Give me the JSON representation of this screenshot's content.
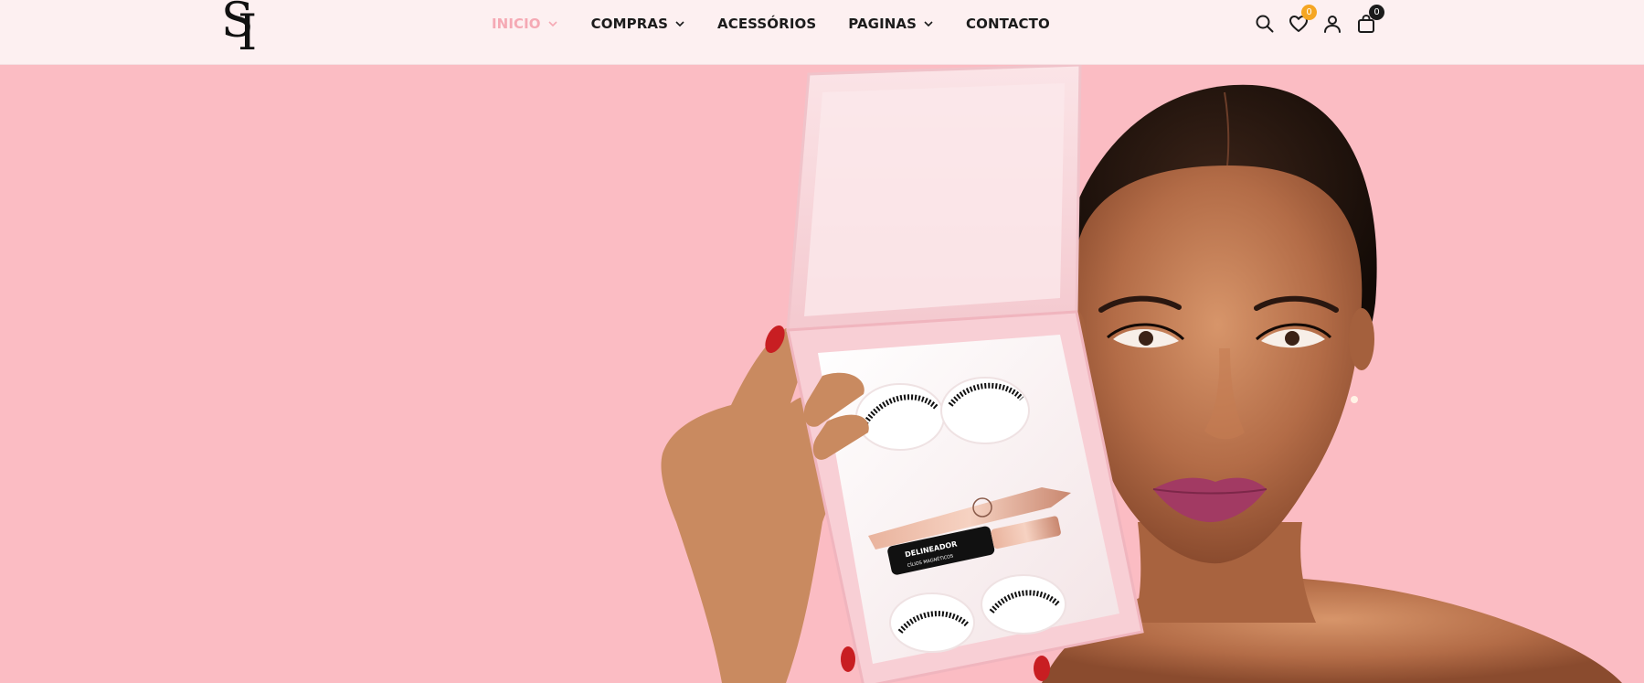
{
  "header": {
    "logo_text": "SI",
    "nav": [
      {
        "label": "INICIO",
        "has_dropdown": true,
        "active": true
      },
      {
        "label": "COMPRAS",
        "has_dropdown": true,
        "active": false
      },
      {
        "label": "ACESSÓRIOS",
        "has_dropdown": false,
        "active": false
      },
      {
        "label": "PAGINAS",
        "has_dropdown": true,
        "active": false
      },
      {
        "label": "CONTACTO",
        "has_dropdown": false,
        "active": false
      }
    ],
    "icons": {
      "search": "search-icon",
      "wishlist": "heart-icon",
      "account": "user-icon",
      "cart": "shopping-bag-icon"
    },
    "wishlist_count": "0",
    "cart_count": "0"
  },
  "hero": {
    "product_label_line1": "DELINEADOR",
    "product_label_line2": "CÍLIOS MAGNÉTICOS"
  },
  "colors": {
    "header_bg": "#fdf0f1",
    "hero_bg": "#fbbcc3",
    "accent_pink": "#f5a9b4",
    "wishlist_badge": "#f5a623",
    "cart_badge": "#1b1b1b",
    "nav_text": "#1b1b1b"
  }
}
